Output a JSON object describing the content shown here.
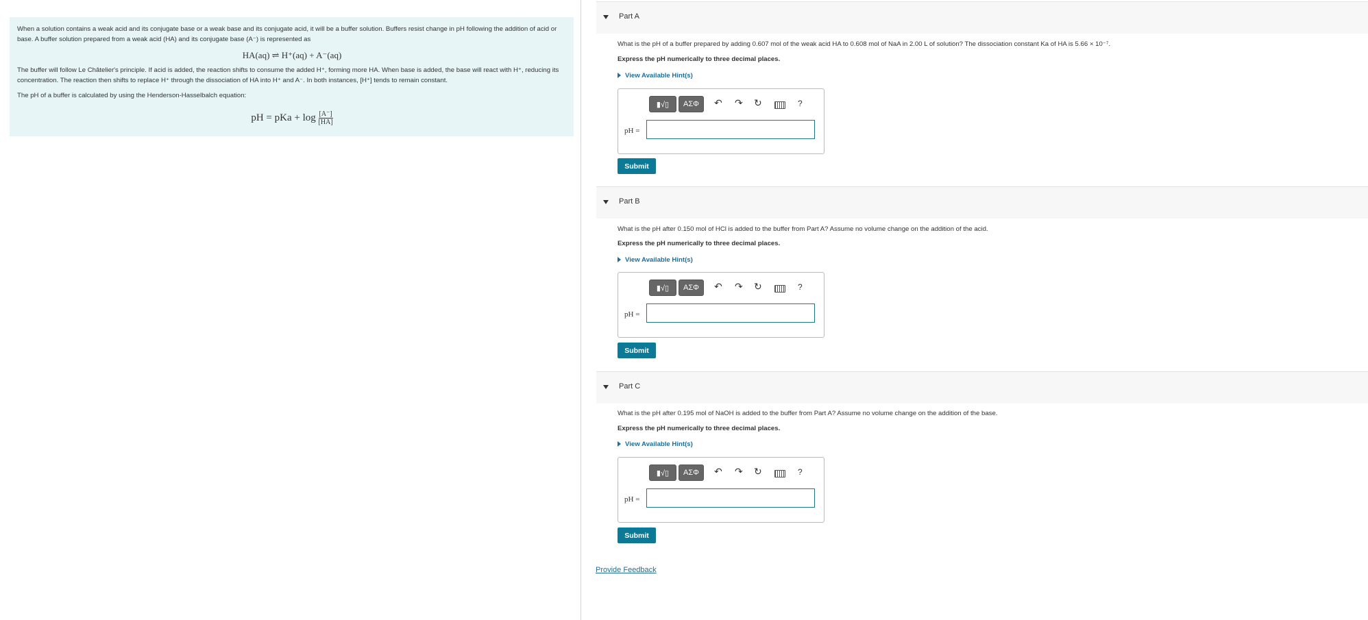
{
  "intro": {
    "p1": "When a solution contains a weak acid and its conjugate base or a weak base and its conjugate acid, it will be a buffer  solution. Buffers resist change in pH following the addition of acid or base. A buffer solution prepared from a weak acid (HA) and its conjugate base (A⁻) is represented as",
    "equation": "HA(aq) ⇌ H⁺(aq) + A⁻(aq)",
    "p2": "The buffer will follow Le Châtelier's principle. If acid is added, the reaction shifts to consume the added H⁺, forming more HA. When base is added, the base will react with H⁺, reducing its concentration. The reaction then shifts to replace H⁺ through the dissociation of HA into H⁺ and A⁻. In both instances, [H⁺] tends to remain constant.",
    "p3": "The pH of a buffer is calculated by using the Henderson-Hasselbalch equation:",
    "hh_left": "pH = pKa + log",
    "hh_num": "[A⁻]",
    "hh_den": "[HA]"
  },
  "parts": [
    {
      "title": "Part A",
      "question": "What is the pH of a buffer prepared by adding 0.607 mol of the weak acid HA to 0.608 mol of NaA in 2.00 L of solution? The dissociation constant Ka of HA is 5.66 × 10⁻⁷.",
      "instruction": "Express the pH numerically to three decimal places.",
      "hint": "View Available Hint(s)",
      "label": "pH =",
      "submit": "Submit"
    },
    {
      "title": "Part B",
      "question": "What is the pH after 0.150 mol of HCl is added to the buffer from Part A? Assume no volume change on the addition of the acid.",
      "instruction": "Express the pH numerically to three decimal places.",
      "hint": "View Available Hint(s)",
      "label": "pH =",
      "submit": "Submit"
    },
    {
      "title": "Part C",
      "question": "What is the pH after 0.195 mol of NaOH is added to the buffer from Part A? Assume no volume change on the addition of the base.",
      "instruction": "Express the pH numerically to three decimal places.",
      "hint": "View Available Hint(s)",
      "label": "pH =",
      "submit": "Submit"
    }
  ],
  "toolbar": {
    "templates": "▮√▯",
    "symbols": "ΑΣΦ",
    "undo": "↶",
    "redo": "↷",
    "reset": "↻",
    "help": "?"
  },
  "feedback": "Provide Feedback"
}
